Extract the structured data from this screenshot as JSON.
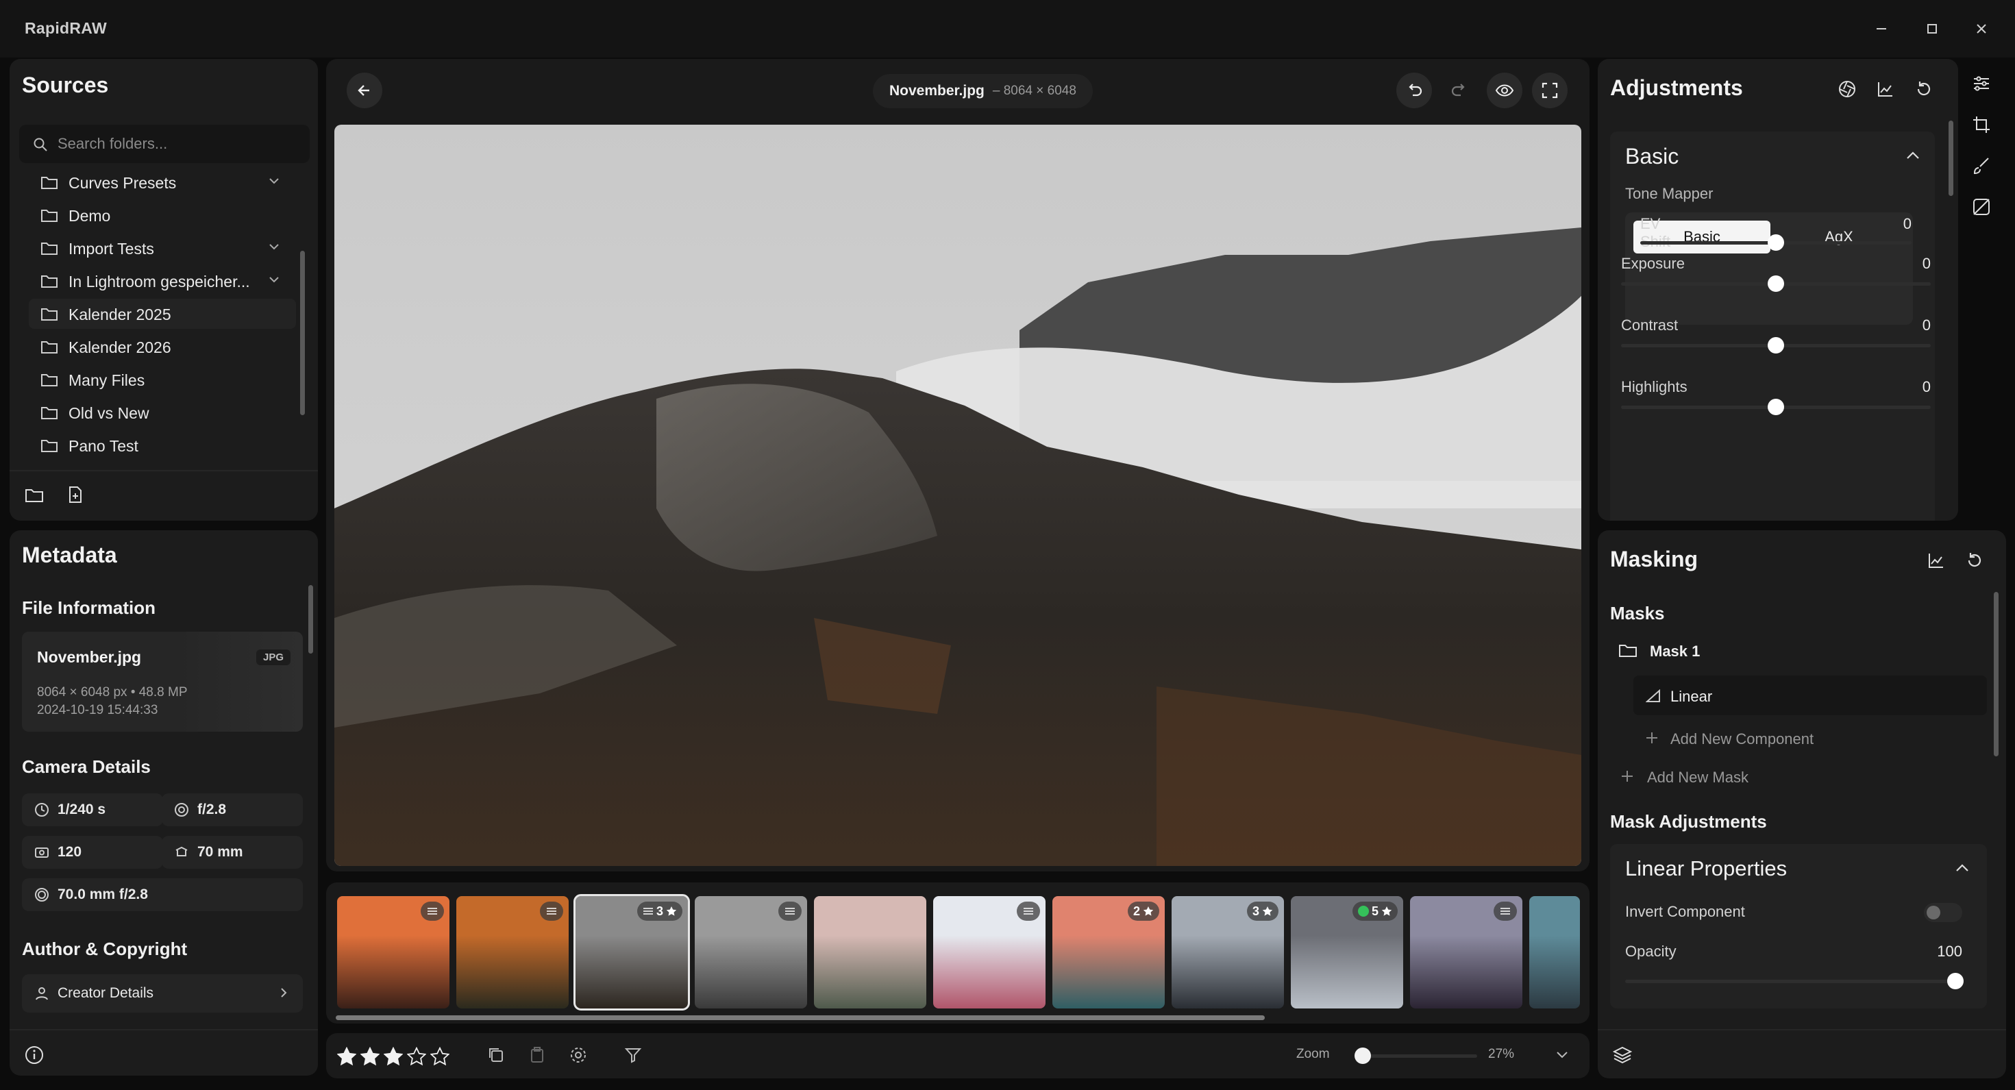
{
  "app": {
    "title": "RapidRAW"
  },
  "sources": {
    "title": "Sources",
    "search_placeholder": "Search folders...",
    "folders": [
      {
        "label": "Curves Presets",
        "expandable": true
      },
      {
        "label": "Demo",
        "expandable": false
      },
      {
        "label": "Import Tests",
        "expandable": true
      },
      {
        "label": "In Lightroom gespeicher...",
        "expandable": true
      },
      {
        "label": "Kalender 2025",
        "expandable": false
      },
      {
        "label": "Kalender 2026",
        "expandable": false
      },
      {
        "label": "Many Files",
        "expandable": false
      },
      {
        "label": "Old vs New",
        "expandable": false
      },
      {
        "label": "Pano Test",
        "expandable": false
      }
    ]
  },
  "metadata": {
    "title": "Metadata",
    "file_info_heading": "File Information",
    "file": {
      "name": "November.jpg",
      "type_badge": "JPG",
      "dimensions": "8064 × 6048 px • 48.8 MP",
      "date": "2024-10-19 15:44:33"
    },
    "camera_heading": "Camera Details",
    "camera": {
      "shutter": "1/240 s",
      "aperture": "f/2.8",
      "iso": "120",
      "focal_length": "70 mm",
      "lens": "70.0 mm f/2.8"
    },
    "author_heading": "Author & Copyright",
    "creator_label": "Creator Details"
  },
  "viewer": {
    "filename": "November.jpg",
    "dimensions": "– 8064 × 6048"
  },
  "filmstrip": {
    "thumbs": [
      {
        "badge": "",
        "edited": true,
        "rating": "",
        "colors": [
          "#e0703a",
          "#3a2018"
        ]
      },
      {
        "badge": "",
        "edited": true,
        "rating": "",
        "colors": [
          "#c46a2a",
          "#2b2a1e"
        ]
      },
      {
        "badge": "3",
        "edited": true,
        "rating": "3",
        "colors": [
          "#8a8a8a",
          "#2c2620"
        ],
        "selected": true
      },
      {
        "badge": "",
        "edited": true,
        "rating": "",
        "colors": [
          "#9a9a9a",
          "#3a3a3a"
        ]
      },
      {
        "badge": "",
        "edited": false,
        "rating": "",
        "colors": [
          "#d6b9b4",
          "#4f5a4c"
        ]
      },
      {
        "badge": "",
        "edited": true,
        "rating": "",
        "colors": [
          "#e5e8ee",
          "#b0556a"
        ]
      },
      {
        "badge": "2",
        "edited": false,
        "rating": "2",
        "colors": [
          "#e0836e",
          "#2f5e64"
        ]
      },
      {
        "badge": "3",
        "edited": false,
        "rating": "3",
        "colors": [
          "#a3aab3",
          "#2a2e34"
        ]
      },
      {
        "badge": "5",
        "edited": false,
        "rating": "5",
        "colors": [
          "#6c6e75",
          "#b9bfc7"
        ],
        "dot": "#35c15a"
      },
      {
        "badge": "",
        "edited": true,
        "rating": "",
        "colors": [
          "#8c8aa0",
          "#2b2433"
        ]
      },
      {
        "badge": "",
        "edited": false,
        "rating": "",
        "colors": [
          "#5e8b99",
          "#2c3a42"
        ]
      }
    ]
  },
  "bottombar": {
    "rating": 3,
    "rating_max": 5,
    "zoom_label": "Zoom",
    "zoom_value": "27%",
    "zoom_fraction": 0.05
  },
  "adjustments": {
    "title": "Adjustments",
    "basic_heading": "Basic",
    "tone_mapper_label": "Tone Mapper",
    "tone_options": [
      "Basic",
      "AgX"
    ],
    "tone_selected": "Basic",
    "sliders": [
      {
        "label": "EV Shift",
        "value": "0",
        "fraction": 0.5
      },
      {
        "label": "Exposure",
        "value": "0",
        "fraction": 0.5
      },
      {
        "label": "Contrast",
        "value": "0",
        "fraction": 0.5
      },
      {
        "label": "Highlights",
        "value": "0",
        "fraction": 0.5
      }
    ]
  },
  "masking": {
    "title": "Masking",
    "masks_heading": "Masks",
    "mask_name": "Mask 1",
    "component_name": "Linear",
    "add_component_label": "Add New Component",
    "add_mask_label": "Add New Mask",
    "mask_adjustments_heading": "Mask Adjustments",
    "properties_heading": "Linear Properties",
    "invert_label": "Invert Component",
    "opacity_label": "Opacity",
    "opacity_value": "100",
    "opacity_fraction": 1.0
  },
  "colors": {
    "accent_green": "#35c15a",
    "panel": "#1c1c1c",
    "background": "#0c0c0c"
  }
}
